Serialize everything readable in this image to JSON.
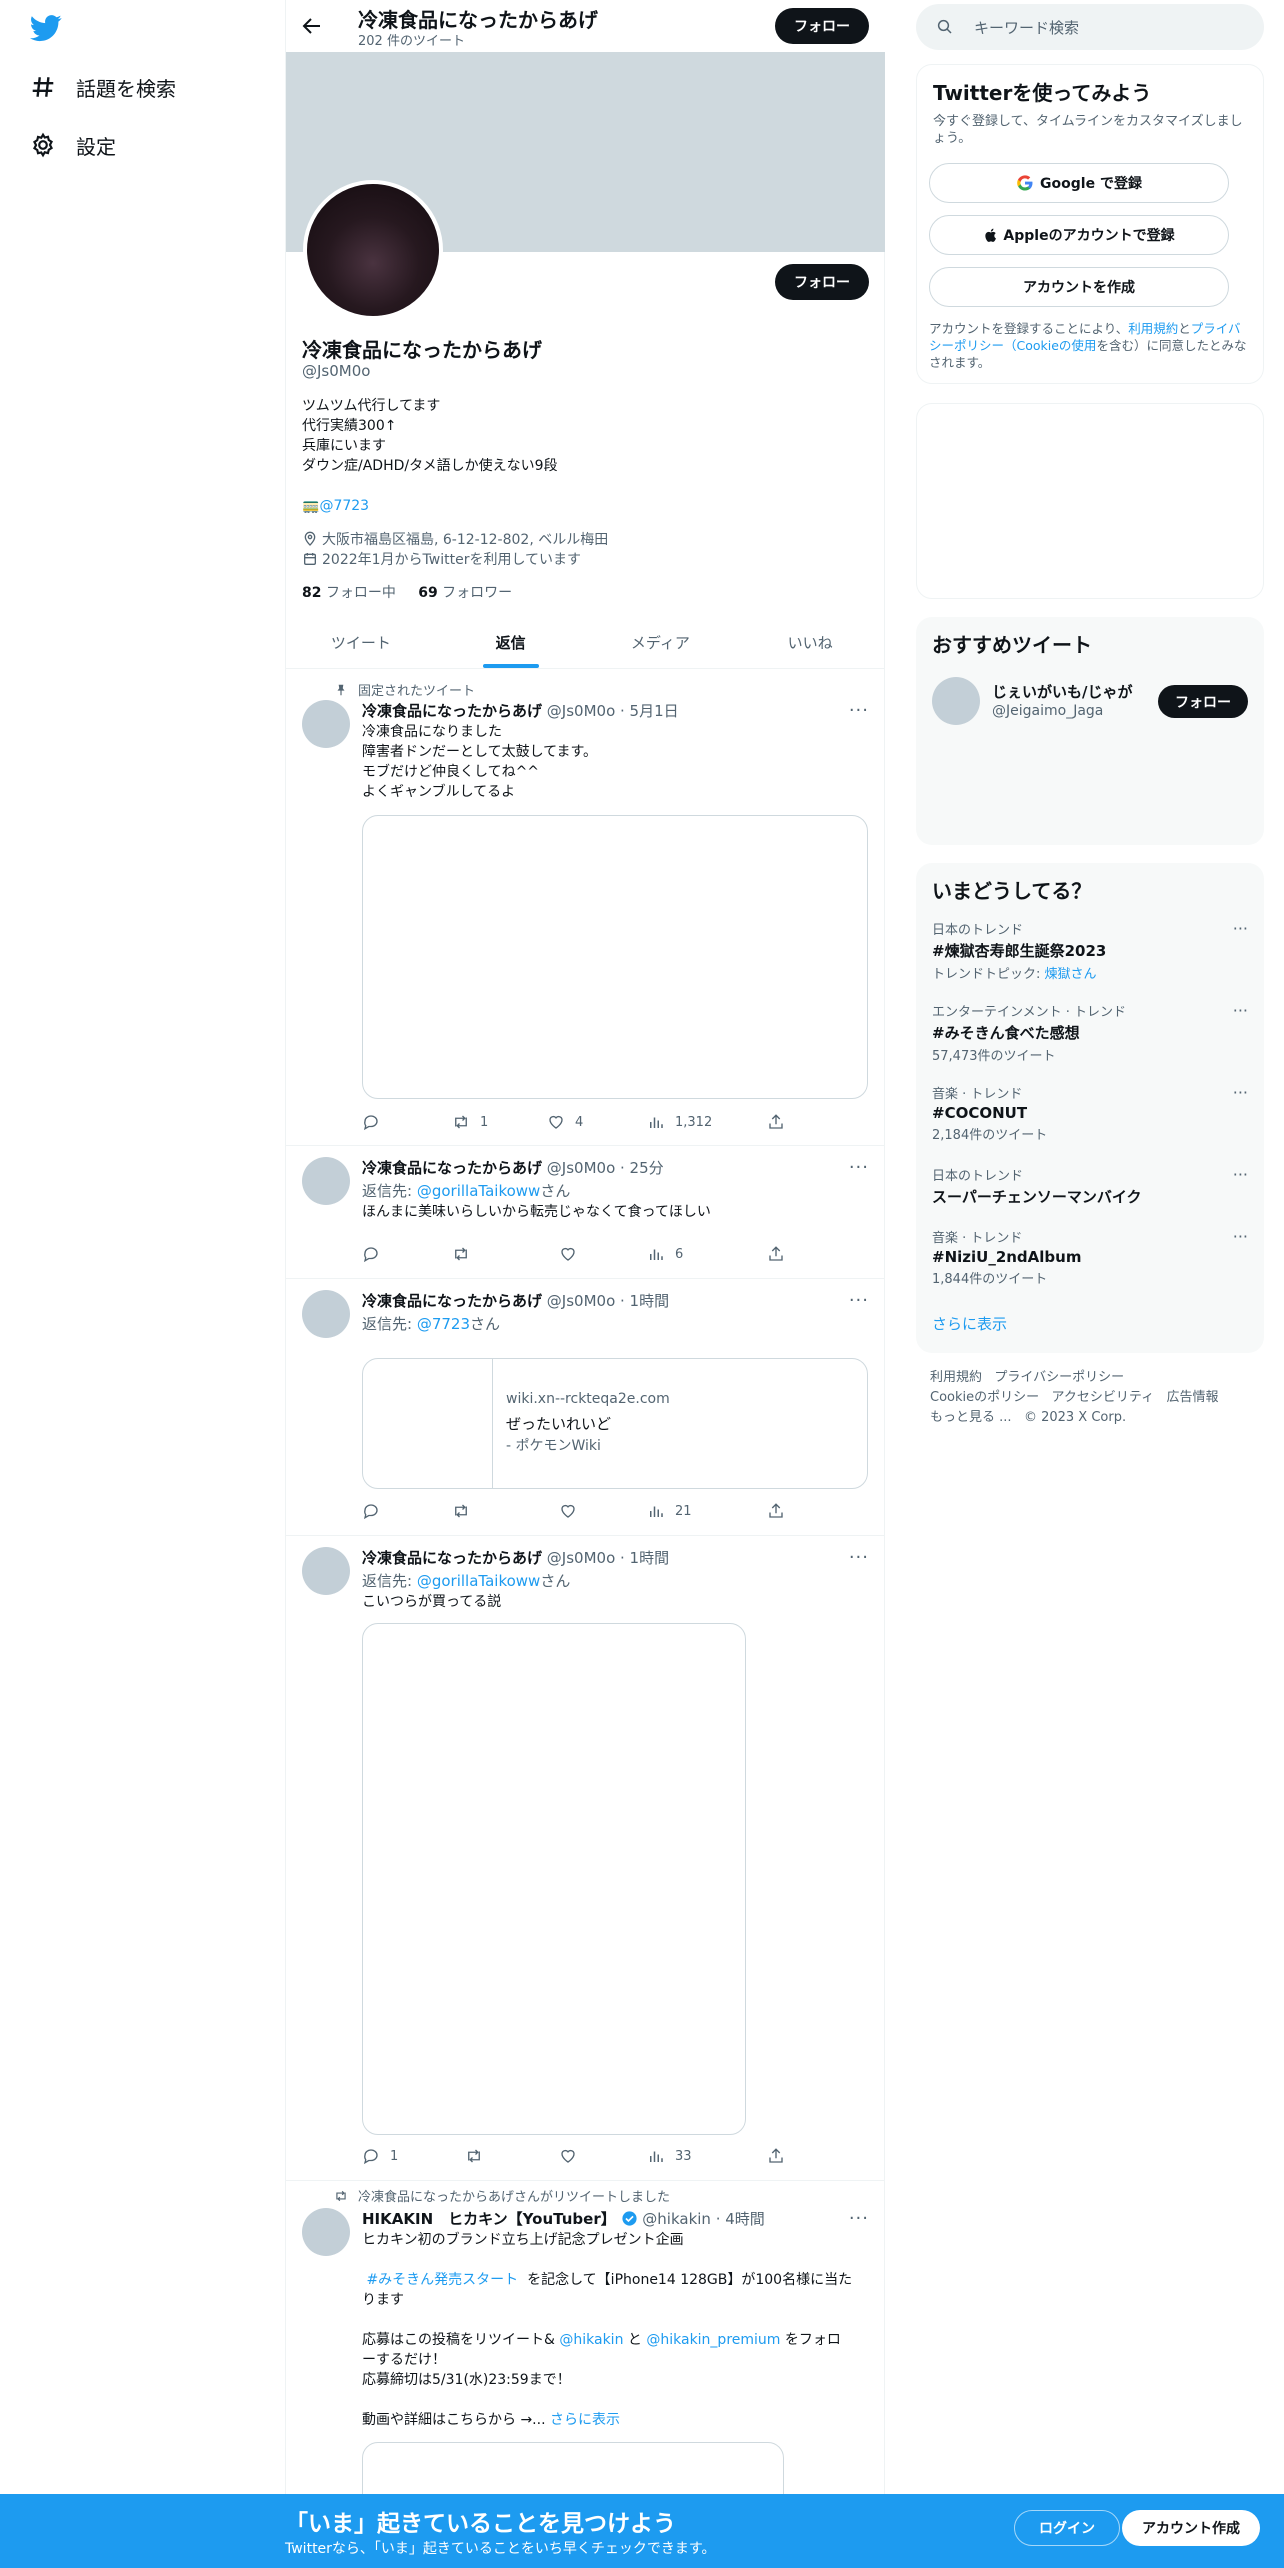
{
  "nav": {
    "explore_label": "話題を検索",
    "settings_label": "設定"
  },
  "header": {
    "name": "冷凍食品になったからあげ",
    "tweet_count": "202 件のツイート",
    "follow_label": "フォロー"
  },
  "profile": {
    "name": "冷凍食品になったからあげ",
    "handle": "@Js0M0o",
    "follow_label": "フォロー",
    "bio_lines": [
      "ツムツム代行してます",
      "代行実績300↑",
      "兵庫にいます",
      "ダウン症/ADHD/タメ語しか使えない9段"
    ],
    "bio_link": "@7723",
    "bio_link_prefix": "🚃",
    "location": "大阪市福島区福島, 6-12-12-802, ベルル梅田",
    "joined": "2022年1月からTwitterを利用しています",
    "following_count": "82",
    "following_label": "フォロー中",
    "followers_count": "69",
    "followers_label": "フォロワー"
  },
  "tabs": [
    "ツイート",
    "返信",
    "メディア",
    "いいね"
  ],
  "tweets": [
    {
      "context": "固定されたツイート",
      "name": "冷凍食品になったからあげ",
      "handle_time": "@Js0M0o · 5月1日",
      "body": "冷凍食品になりました\n障害者ドンだーとして太鼓してます。\nモブだけど仲良くしてね^^\nよくギャンブルしてるよ",
      "retweets": "1",
      "likes": "4",
      "views": "1,312"
    },
    {
      "name": "冷凍食品になったからあげ",
      "handle_time": "@Js0M0o · 25分",
      "reply_prefix": "返信先:",
      "reply_to": "@gorillaTaikoww",
      "reply_suffix": "さん",
      "body": "ほんまに美味いらしいから転売じゃなくて食ってほしい",
      "views": "6"
    },
    {
      "name": "冷凍食品になったからあげ",
      "handle_time": "@Js0M0o · 1時間",
      "reply_prefix": "返信先:",
      "reply_to": "@7723",
      "reply_suffix": "さん",
      "card_domain": "wiki.xn--rckteqa2e.com",
      "card_title": "ぜったいれいど",
      "card_desc": "- ポケモンWiki",
      "views": "21"
    },
    {
      "name": "冷凍食品になったからあげ",
      "handle_time": "@Js0M0o · 1時間",
      "reply_prefix": "返信先:",
      "reply_to": "@gorillaTaikoww",
      "reply_suffix": "さん",
      "body": "こいつらが買ってる説",
      "replies": "1",
      "views": "33"
    },
    {
      "context": "冷凍食品になったからあげさんがリツイートしました",
      "name": "HIKAKIN　ヒカキン【YouTuber】",
      "handle_time": "@hikakin · 4時間",
      "line1": "ヒカキン初のブランド立ち上げ記念プレゼント企画",
      "hashtag": "#みそきん発売スタート",
      "line2a": "を記念して【iPhone14 128GB】が100名様に当た",
      "line2b": "ります",
      "line3a": "応募はこの投稿をリツイート&",
      "mention1": "@hikakin",
      "and": "と",
      "mention2": "@hikakin_premium",
      "line3b": "をフォロ",
      "line3c": "ーするだけ！",
      "line4": "応募締切は5/31(水)23:59まで！",
      "line5": "動画や詳細はこちらから →...",
      "show_more": "さらに表示"
    }
  ],
  "search": {
    "placeholder": "キーワード検索"
  },
  "signup_card": {
    "title": "Twitterを使ってみよう",
    "subtitle": "今すぐ登録して、タイムラインをカスタマイズしましょう。",
    "google_label": "Google で登録",
    "apple_label": "Appleのアカウントで登録",
    "create_label": "アカウントを作成",
    "terms_pre": "アカウントを登録することにより、",
    "terms_link1": "利用規約",
    "terms_mid": "と",
    "terms_link2": "プライバシーポリシー（Cookieの使用",
    "terms_post": "を含む）に同意したとみなされます。"
  },
  "recommend": {
    "title": "おすすめツイート",
    "name": "じぇいがいも/じゃが",
    "handle": "@Jeigaimo_Jaga",
    "follow_label": "フォロー"
  },
  "trends": {
    "title": "いまどうしてる？",
    "items": [
      {
        "category": "日本のトレンド",
        "name": "#煉獄杏寿郎生誕祭2023",
        "extra_prefix": "トレンドトピック: ",
        "extra_link": "煉獄さん"
      },
      {
        "category": "エンターテインメント · トレンド",
        "name": "#みそきん食べた感想",
        "count": "57,473件のツイート"
      },
      {
        "category": "音楽 · トレンド",
        "name": "#COCONUT",
        "count": "2,184件のツイート"
      },
      {
        "category": "日本のトレンド",
        "name": "スーパーチェンソーマンバイク"
      },
      {
        "category": "音楽 · トレンド",
        "name": "#NiziU_2ndAlbum",
        "count": "1,844件のツイート"
      }
    ],
    "show_more": "さらに表示"
  },
  "footer": {
    "terms": "利用規約",
    "privacy": "プライバシーポリシー",
    "cookie": "Cookieのポリシー",
    "accessibility": "アクセシビリティ",
    "ads": "広告情報",
    "more": "もっと見る ...",
    "copyright": "© 2023 X Corp."
  },
  "bottom_bar": {
    "title": "「いま」起きていることを見つけよう",
    "subtitle": "Twitterなら、「いま」起きていることをいち早くチェックできます。",
    "login": "ログイン",
    "signup": "アカウント作成"
  },
  "colors": {
    "accent": "#1d9bf0",
    "dark": "#0f1419",
    "muted": "#536471",
    "banner": "#cfd9de"
  }
}
